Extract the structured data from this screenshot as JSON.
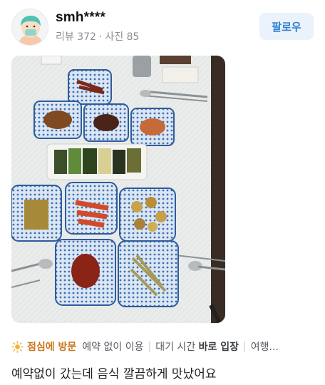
{
  "user": {
    "name": "smh****",
    "review_count_label": "리뷰 372",
    "photo_count_label": "사진 85",
    "separator": "·"
  },
  "follow_button": {
    "label": "팔로우"
  },
  "visit_info": {
    "icon": "sun-icon",
    "meal_time": "점심에 방문",
    "tags": [
      {
        "plain": "예약 없이 이용",
        "bold": ""
      },
      {
        "plain": "대기 시간 ",
        "bold": "바로 입장"
      },
      {
        "plain": "여행...",
        "bold": ""
      }
    ]
  },
  "review": {
    "text": "예약없이 갔는데 음식 깔끔하게 맛났어요"
  },
  "colors": {
    "follow_bg": "#eaf3fc",
    "follow_text": "#2f7fd2",
    "meal_tag": "#c9781b",
    "meta_text": "#8a8f96"
  }
}
